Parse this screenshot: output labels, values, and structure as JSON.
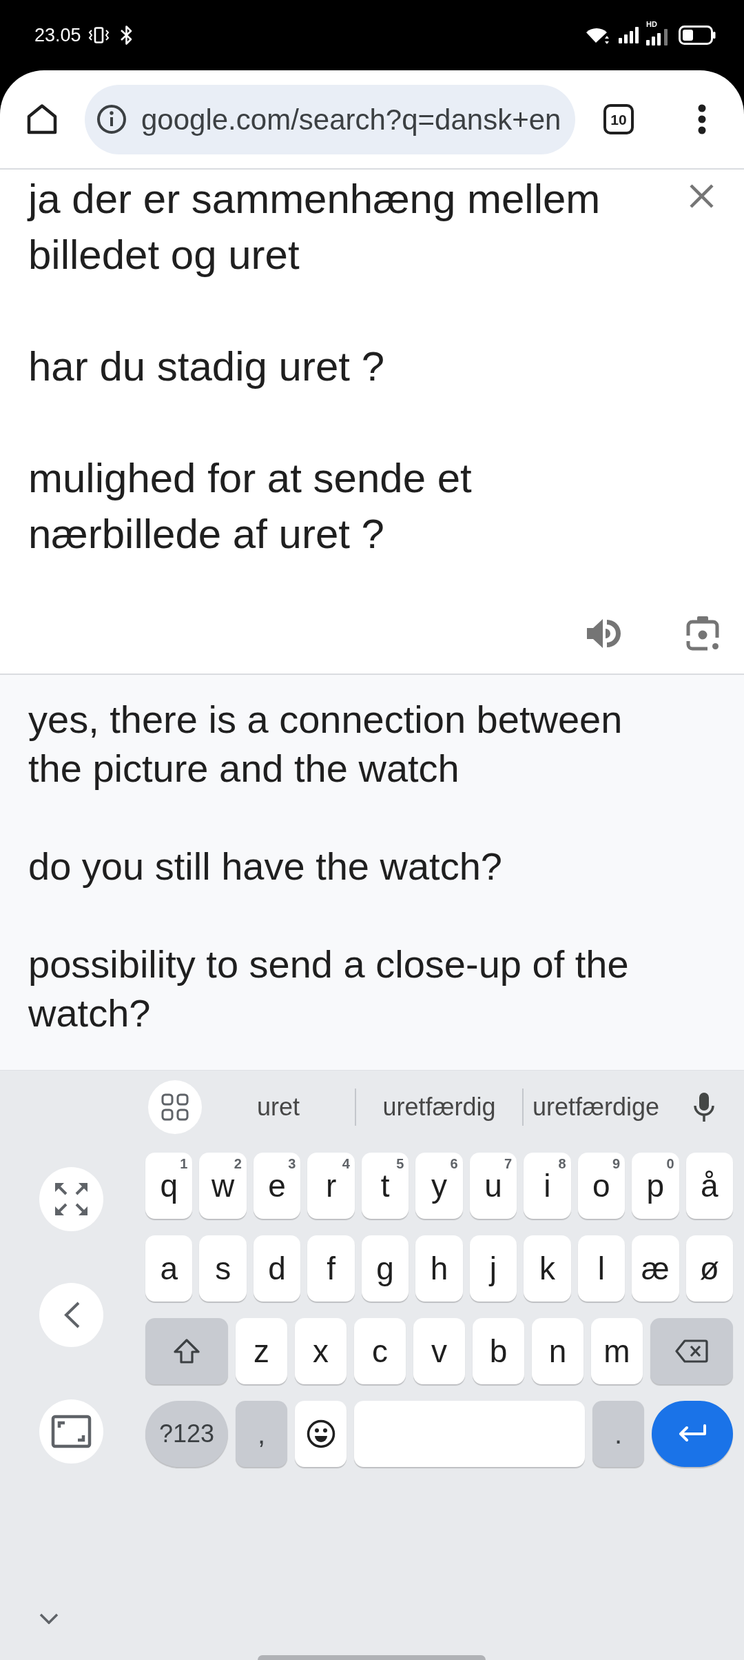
{
  "status_bar": {
    "time": "23.05",
    "network_label": "HD"
  },
  "toolbar": {
    "url": "google.com/search?q=dansk+en",
    "tab_count": "10"
  },
  "source": {
    "text": "ja der er sammenhæng mellem billedet og uret\n\nhar du stadig uret ?\n\nmulighed for at sende et nærbillede af uret ?"
  },
  "translation": {
    "paragraphs": [
      "yes, there is a connection between the picture and the watch",
      "do you still have the watch?",
      "possibility to send a close-up of the watch?"
    ]
  },
  "keyboard": {
    "suggestions": [
      "uret",
      "uretfærdig",
      "uretfærdige"
    ],
    "rows": [
      {
        "keys": [
          {
            "kind": "letter",
            "label": "q",
            "hint": "1"
          },
          {
            "kind": "letter",
            "label": "w",
            "hint": "2"
          },
          {
            "kind": "letter",
            "label": "e",
            "hint": "3"
          },
          {
            "kind": "letter",
            "label": "r",
            "hint": "4"
          },
          {
            "kind": "letter",
            "label": "t",
            "hint": "5"
          },
          {
            "kind": "letter",
            "label": "y",
            "hint": "6"
          },
          {
            "kind": "letter",
            "label": "u",
            "hint": "7"
          },
          {
            "kind": "letter",
            "label": "i",
            "hint": "8"
          },
          {
            "kind": "letter",
            "label": "o",
            "hint": "9"
          },
          {
            "kind": "letter",
            "label": "p",
            "hint": "0"
          },
          {
            "kind": "letter",
            "label": "å"
          }
        ]
      },
      {
        "keys": [
          {
            "kind": "letter",
            "label": "a"
          },
          {
            "kind": "letter",
            "label": "s"
          },
          {
            "kind": "letter",
            "label": "d"
          },
          {
            "kind": "letter",
            "label": "f"
          },
          {
            "kind": "letter",
            "label": "g"
          },
          {
            "kind": "letter",
            "label": "h"
          },
          {
            "kind": "letter",
            "label": "j"
          },
          {
            "kind": "letter",
            "label": "k"
          },
          {
            "kind": "letter",
            "label": "l"
          },
          {
            "kind": "letter",
            "label": "æ"
          },
          {
            "kind": "letter",
            "label": "ø"
          }
        ]
      },
      {
        "keys": [
          {
            "kind": "shift"
          },
          {
            "kind": "letter",
            "label": "z"
          },
          {
            "kind": "letter",
            "label": "x"
          },
          {
            "kind": "letter",
            "label": "c"
          },
          {
            "kind": "letter",
            "label": "v"
          },
          {
            "kind": "letter",
            "label": "b"
          },
          {
            "kind": "letter",
            "label": "n"
          },
          {
            "kind": "letter",
            "label": "m"
          },
          {
            "kind": "backspace"
          }
        ]
      },
      {
        "keys": [
          {
            "kind": "symbols",
            "label": "?123"
          },
          {
            "kind": "punctuation",
            "label": ","
          },
          {
            "kind": "emoji"
          },
          {
            "kind": "space"
          },
          {
            "kind": "punctuation",
            "label": "."
          },
          {
            "kind": "enter"
          }
        ]
      }
    ]
  }
}
